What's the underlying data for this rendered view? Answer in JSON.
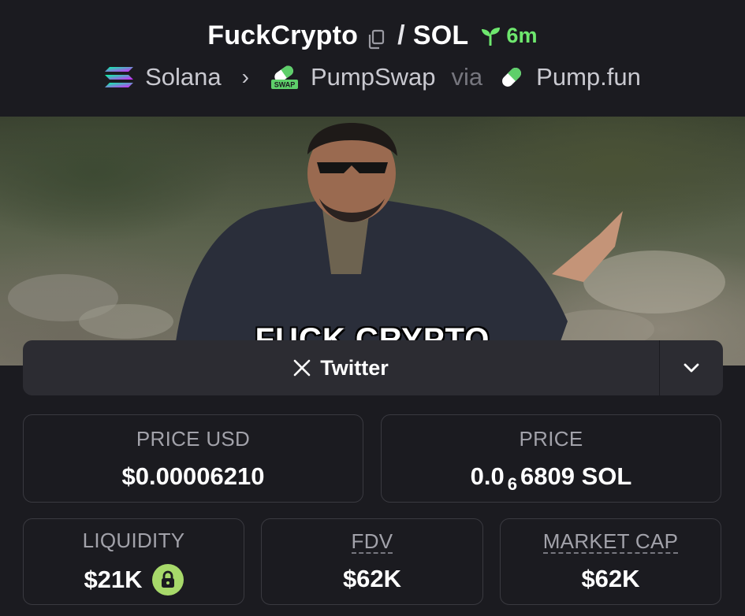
{
  "header": {
    "token_name": "FuckCrypto",
    "pair_separator": "/",
    "quote": "SOL",
    "age": "6m",
    "chain": "Solana",
    "dex": "PumpSwap",
    "via_label": "via",
    "launchpad": "Pump.fun",
    "swap_badge_text": "SWAP"
  },
  "banner": {
    "caption": "FUCK CRYPTO"
  },
  "social": {
    "label": "Twitter"
  },
  "stats": {
    "price_usd": {
      "label": "PRICE USD",
      "value": "$0.00006210"
    },
    "price_native": {
      "label": "PRICE",
      "prefix": "0.0",
      "zeros": "6",
      "suffix": "6809 SOL"
    },
    "liquidity": {
      "label": "LIQUIDITY",
      "value": "$21K"
    },
    "fdv": {
      "label": "FDV",
      "value": "$62K"
    },
    "market_cap": {
      "label": "MARKET CAP",
      "value": "$62K"
    }
  },
  "colors": {
    "background": "#1b1b20",
    "age_green": "#6ee76e",
    "lock_green": "#a7d96a",
    "card_border": "#3a3a40"
  },
  "icons": [
    "copy-icon",
    "seedling-icon",
    "solana-logo-icon",
    "pumpswap-pill-icon",
    "pumpfun-pill-icon",
    "x-logo-icon",
    "chevron-down-icon",
    "lock-icon"
  ]
}
